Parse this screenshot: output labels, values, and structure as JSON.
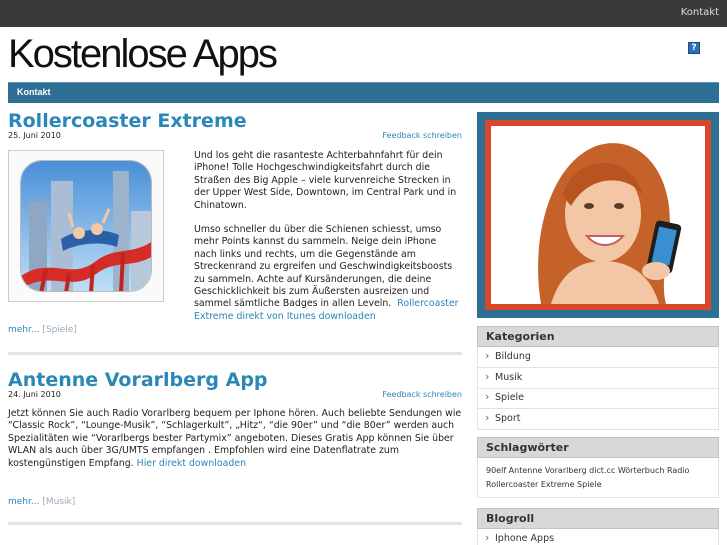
{
  "topbar": {
    "link": "Kontakt"
  },
  "site": {
    "title": "Kostenlose Apps",
    "help_label": "?"
  },
  "nav": {
    "items": [
      "Kontakt"
    ]
  },
  "posts": [
    {
      "title": "Rollercoaster Extreme",
      "date": "25. Juni 2010",
      "feedback": "Feedback schreiben",
      "p1": "Und los geht die rasanteste Achterbahnfahrt für dein iPhone! Tolle Hochgeschwindigkeitsfahrt durch die Straßen des Big Apple – viele kurvenreiche Strecken in der Upper West Side, Downtown, im Central Park und in Chinatown.",
      "p2": "Umso schneller du über die Schienen schiesst, umso mehr Points kannst du sammeln. Neige dein iPhone nach links und rechts, um die Gegenstände am Streckenrand zu ergreifen und Geschwindigkeitsboosts zu sammeln. Achte auf Kursänderungen, die deine Geschicklichkeit bis zum Äußersten ausreizen und sammel sämtliche Badges in allen Leveln.",
      "link": "Rollercoaster Extreme direkt von Itunes downloaden",
      "more": "mehr...",
      "category": "[Spiele]"
    },
    {
      "title": "Antenne Vorarlberg App",
      "date": "24. Juni 2010",
      "feedback": "Feedback schreiben",
      "p1": "Jetzt können Sie auch Radio Vorarlberg bequem per Iphone hören. Auch beliebte Sendungen wie “Classic Rock”, “Lounge-Musik”, “Schlagerkult”, „Hitz“, “die 90er” und “die 80er” werden auch Spezialitäten wie “Vorarlbergs bester Partymix” angeboten.  Dieses Gratis App können Sie über WLAN als auch über 3G/UMTS empfangen . Empfohlen wird eine Datenflatrate zum kostengünstigen Empfang.",
      "link": "Hier direkt downloaden",
      "more": "mehr...",
      "category": "[Musik]"
    }
  ],
  "sidebar": {
    "kategorien": {
      "title": "Kategorien",
      "items": [
        "Bildung",
        "Musik",
        "Spiele",
        "Sport"
      ]
    },
    "schlagwoerter": {
      "title": "Schlagwörter",
      "tags": "90elf Antenne Vorarlberg dict.cc Wörterbuch Radio Rollercoaster Extreme Spiele"
    },
    "blogroll": {
      "title": "Blogroll",
      "items": [
        "Iphone Apps"
      ]
    }
  },
  "colors": {
    "accent": "#2a87b8",
    "nav": "#2e7095",
    "photo_frame": "#d9472a",
    "topbar": "#3a3a3a"
  },
  "icons": {
    "help": "help-icon",
    "bullet": "chevron-right-icon"
  }
}
